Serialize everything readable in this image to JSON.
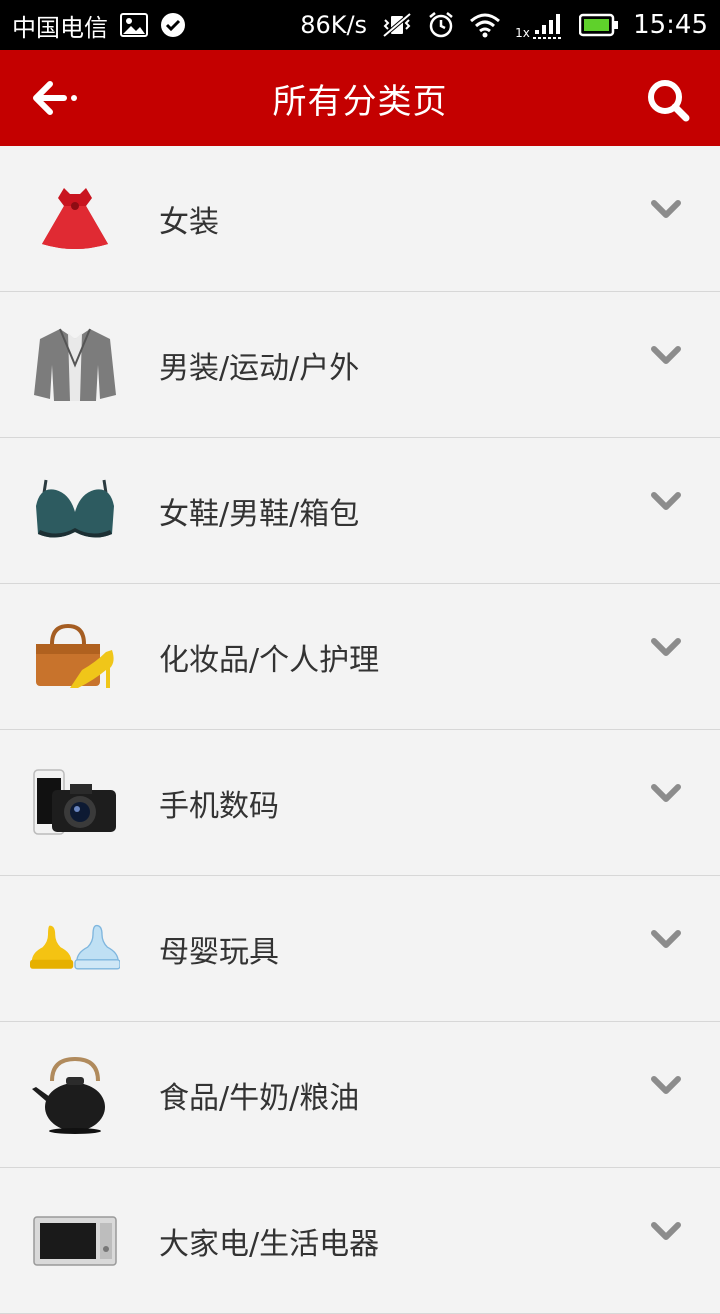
{
  "status_bar": {
    "carrier": "中国电信",
    "speed": "86K/s",
    "signal_label": "1x",
    "time": "15:45"
  },
  "header": {
    "title": "所有分类页"
  },
  "categories": [
    {
      "label": "女装",
      "icon": "dress-icon"
    },
    {
      "label": "男装/运动/户外",
      "icon": "jacket-icon"
    },
    {
      "label": "女鞋/男鞋/箱包",
      "icon": "bra-icon"
    },
    {
      "label": "化妆品/个人护理",
      "icon": "handbag-heel-icon"
    },
    {
      "label": "手机数码",
      "icon": "phone-camera-icon"
    },
    {
      "label": "母婴玩具",
      "icon": "baby-bottle-nipple-icon"
    },
    {
      "label": "食品/牛奶/粮油",
      "icon": "teapot-icon"
    },
    {
      "label": "大家电/生活电器",
      "icon": "microwave-icon"
    }
  ],
  "colors": {
    "header_bg": "#c40000",
    "list_bg": "#f3f3f3",
    "chevron": "#8c8c8c"
  }
}
